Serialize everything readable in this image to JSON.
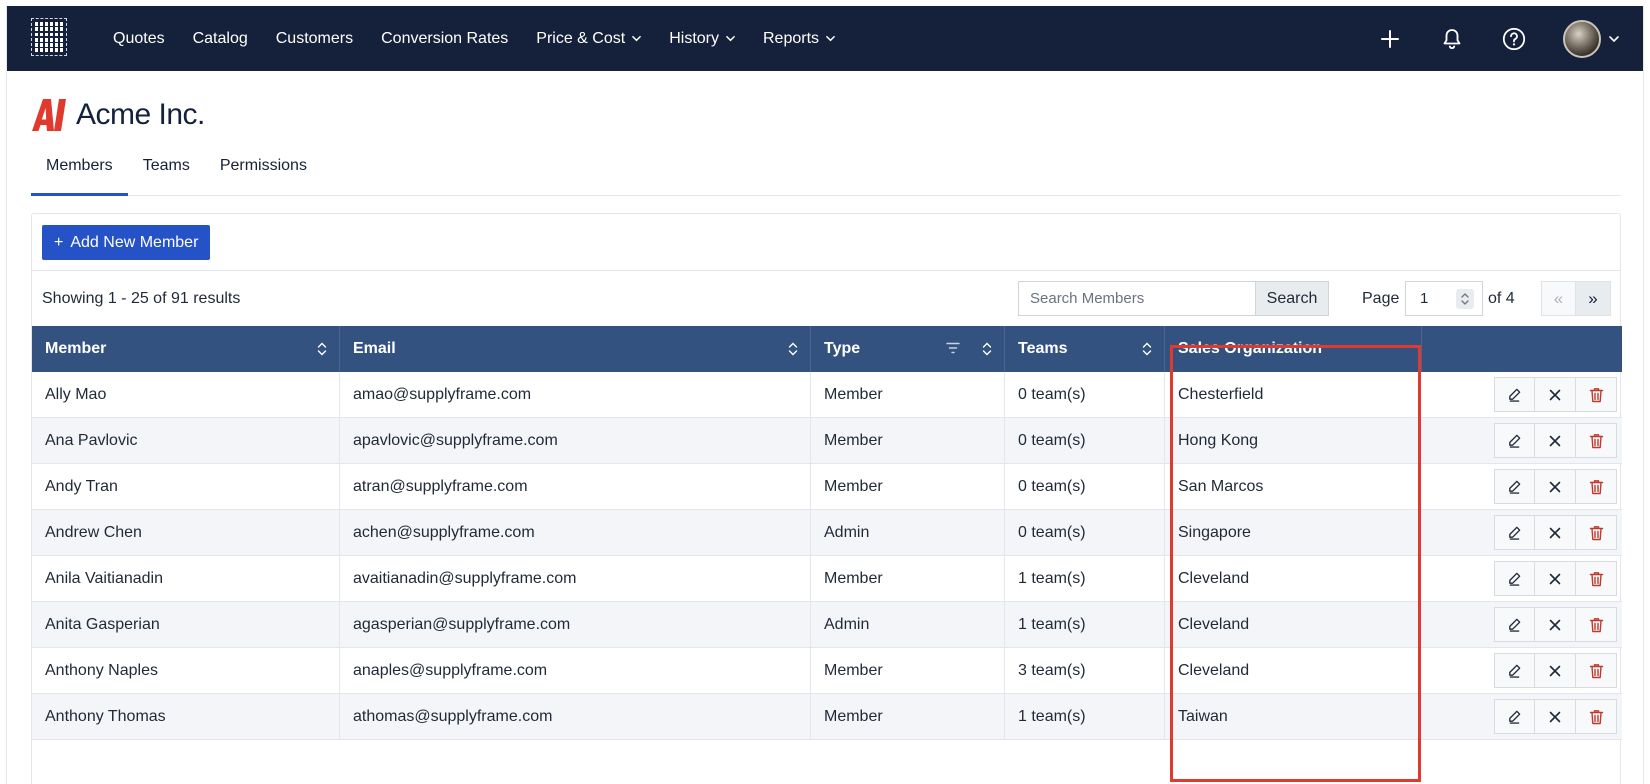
{
  "nav": {
    "items": [
      {
        "label": "Quotes",
        "dropdown": false
      },
      {
        "label": "Catalog",
        "dropdown": false
      },
      {
        "label": "Customers",
        "dropdown": false
      },
      {
        "label": "Conversion Rates",
        "dropdown": false
      },
      {
        "label": "Price & Cost",
        "dropdown": true
      },
      {
        "label": "History",
        "dropdown": true
      },
      {
        "label": "Reports",
        "dropdown": true
      }
    ],
    "icons": [
      "plus-icon",
      "bell-icon",
      "help-icon",
      "avatar"
    ]
  },
  "company": {
    "name": "Acme Inc.",
    "logo": "AI"
  },
  "tabs": [
    {
      "label": "Members",
      "active": true
    },
    {
      "label": "Teams",
      "active": false
    },
    {
      "label": "Permissions",
      "active": false
    }
  ],
  "toolbar": {
    "add_label": "Add New Member",
    "showing": "Showing 1 - 25 of 91 results",
    "search_placeholder": "Search Members",
    "search_label": "Search",
    "page_label": "Page",
    "page_value": "1",
    "of_label": "of 4",
    "prev_label": "«",
    "next_label": "»"
  },
  "table": {
    "headers": [
      "Member",
      "Email",
      "Type",
      "Teams",
      "Sales Organization"
    ],
    "rows": [
      {
        "member": "Ally Mao",
        "email": "amao@supplyframe.com",
        "type": "Member",
        "teams": "0 team(s)",
        "org": "Chesterfield"
      },
      {
        "member": "Ana Pavlovic",
        "email": "apavlovic@supplyframe.com",
        "type": "Member",
        "teams": "0 team(s)",
        "org": "Hong Kong"
      },
      {
        "member": "Andy Tran",
        "email": "atran@supplyframe.com",
        "type": "Member",
        "teams": "0 team(s)",
        "org": "San Marcos"
      },
      {
        "member": "Andrew Chen",
        "email": "achen@supplyframe.com",
        "type": "Admin",
        "teams": "0 team(s)",
        "org": "Singapore"
      },
      {
        "member": "Anila Vaitianadin",
        "email": "avaitianadin@supplyframe.com",
        "type": "Member",
        "teams": "1 team(s)",
        "org": "Cleveland"
      },
      {
        "member": "Anita Gasperian",
        "email": "agasperian@supplyframe.com",
        "type": "Admin",
        "teams": "1 team(s)",
        "org": "Cleveland"
      },
      {
        "member": "Anthony Naples",
        "email": "anaples@supplyframe.com",
        "type": "Member",
        "teams": "3 team(s)",
        "org": "Cleveland"
      },
      {
        "member": "Anthony Thomas",
        "email": "athomas@supplyframe.com",
        "type": "Member",
        "teams": "1 team(s)",
        "org": "Taiwan"
      }
    ]
  },
  "colors": {
    "nav_bg": "#15213a",
    "header_bg": "#34527f",
    "accent": "#2552c7",
    "highlight": "#e03a2f",
    "danger": "#c0392b"
  }
}
